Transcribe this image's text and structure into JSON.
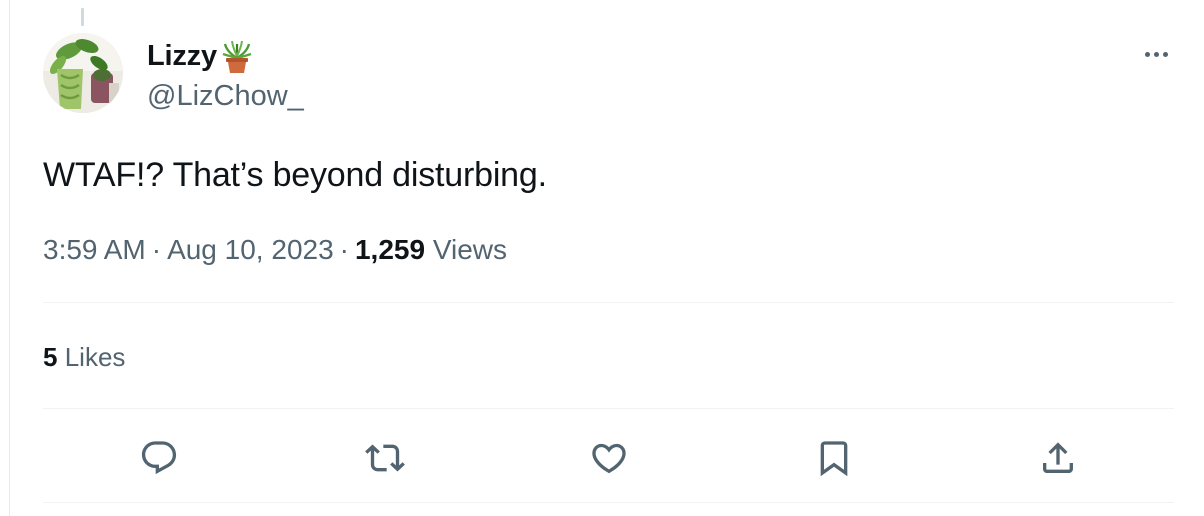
{
  "author": {
    "display_name": "Lizzy",
    "handle": "@LizChow_",
    "name_emoji": "potted-plant-emoji",
    "avatar": "plant-photo-avatar"
  },
  "tweet": {
    "text": "WTAF!? That’s beyond disturbing.",
    "time": "3:59 AM",
    "date": "Aug 10, 2023",
    "separator": "·",
    "views_count": "1,259",
    "views_label": "Views"
  },
  "engagement": {
    "likes_count": "5",
    "likes_label": "Likes"
  },
  "actions": [
    {
      "name": "reply",
      "icon": "reply-icon"
    },
    {
      "name": "retweet",
      "icon": "retweet-icon"
    },
    {
      "name": "like",
      "icon": "heart-icon"
    },
    {
      "name": "bookmark",
      "icon": "bookmark-icon"
    },
    {
      "name": "share",
      "icon": "share-icon"
    }
  ],
  "menu": {
    "icon": "more-options-icon"
  },
  "colors": {
    "text_primary": "#0f1419",
    "text_secondary": "#536471",
    "divider": "#eff3f4",
    "background": "#ffffff"
  }
}
